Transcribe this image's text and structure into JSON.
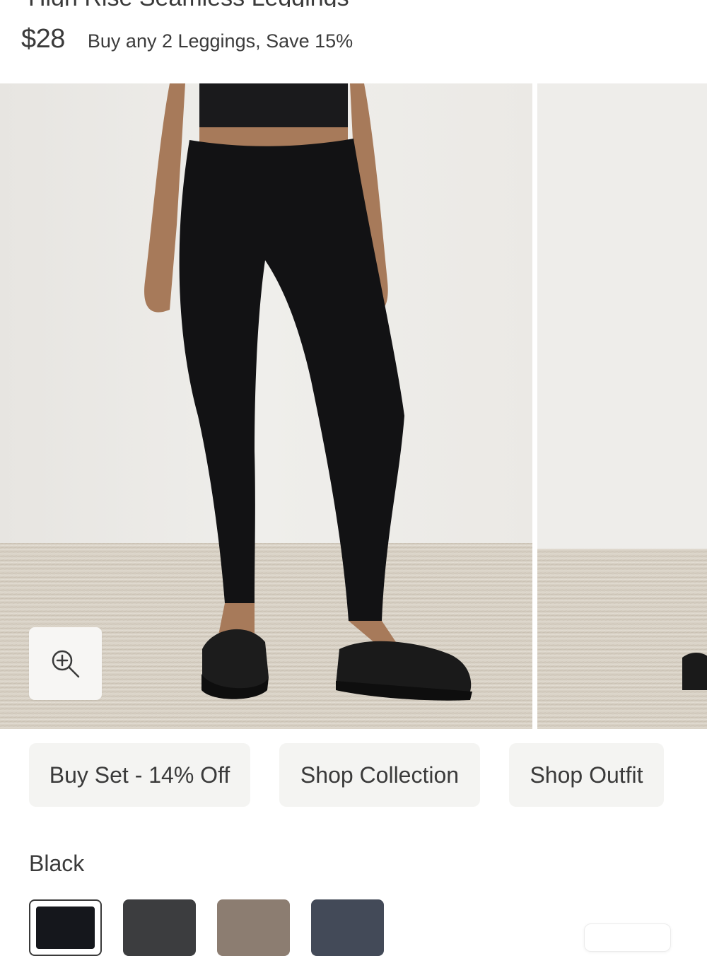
{
  "product": {
    "title": "High Rise Seamless Leggings",
    "price": "$28",
    "promo": "Buy any 2 Leggings, Save 15%"
  },
  "gallery": {
    "zoom_icon": "zoom-in-icon"
  },
  "actions": {
    "buy_set": "Buy Set - 14% Off",
    "shop_collection": "Shop Collection",
    "shop_outfit": "Shop Outfit"
  },
  "color": {
    "selected_label": "Black",
    "swatches": [
      {
        "name": "Black",
        "hex": "#15171c"
      },
      {
        "name": "Charcoal",
        "hex": "#3c3d3f"
      },
      {
        "name": "Taupe",
        "hex": "#8c7d71"
      },
      {
        "name": "Slate Blue",
        "hex": "#434a58"
      }
    ]
  },
  "colors": {
    "text": "#3a3a3a",
    "button_bg": "#f4f4f2",
    "wall": "#ecebe8",
    "carpet": "#d9d2c6"
  }
}
